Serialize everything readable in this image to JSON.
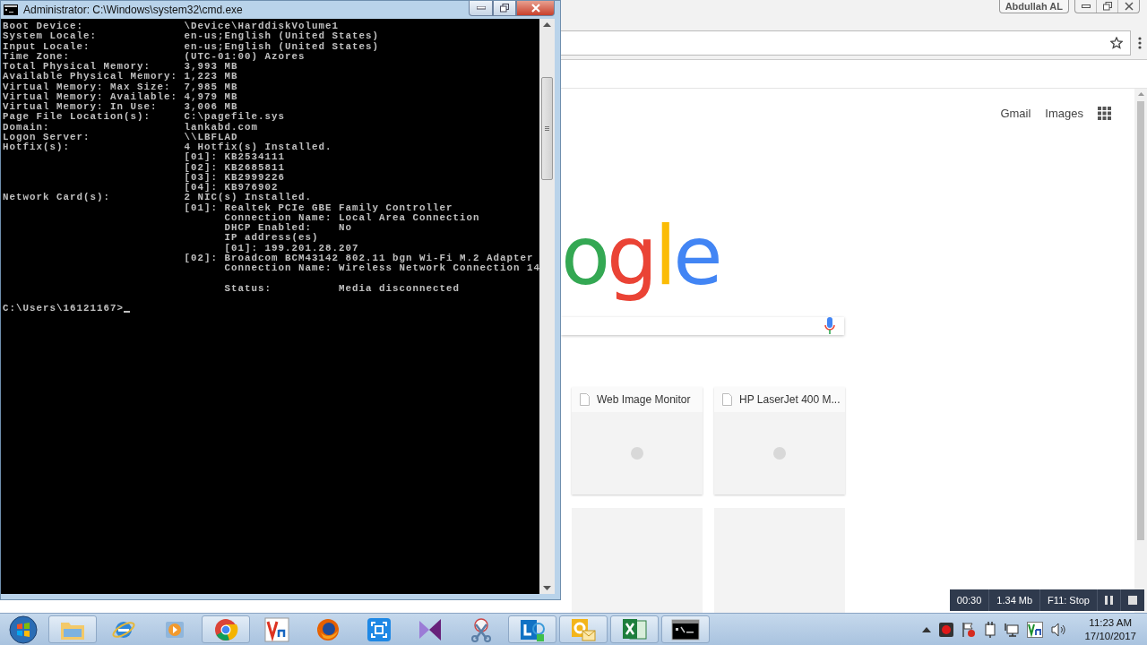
{
  "cmd_window": {
    "title": "Administrator: C:\\Windows\\system32\\cmd.exe",
    "lines": [
      {
        "text": "Boot Device:               \\Device\\HarddiskVolume1"
      },
      {
        "text": "System Locale:             en-us;English (United States)"
      },
      {
        "text": "Input Locale:              en-us;English (United States)"
      },
      {
        "text": "Time Zone:                 (UTC-01:00) Azores"
      },
      {
        "text": "Total Physical Memory:     3,993 MB"
      },
      {
        "text": "Available Physical Memory: 1,223 MB"
      },
      {
        "text": "Virtual Memory: Max Size:  7,985 MB"
      },
      {
        "text": "Virtual Memory: Available: 4,979 MB"
      },
      {
        "text": "Virtual Memory: In Use:    3,006 MB"
      },
      {
        "text": "Page File Location(s):     C:\\pagefile.sys"
      },
      {
        "text": "Domain:                    lankabd.com"
      },
      {
        "text": "Logon Server:              \\\\LBFLAD"
      },
      {
        "text": "Hotfix(s):                 4 Hotfix(s) Installed."
      },
      {
        "text": "                           [01]: KB2534111"
      },
      {
        "text": "                           [02]: KB2685811"
      },
      {
        "text": "                           [03]: KB2999226"
      },
      {
        "text": "                           [04]: KB976902"
      },
      {
        "text": "Network Card(s):           2 NIC(s) Installed."
      },
      {
        "text": "                           [01]: Realtek PCIe GBE Family Controller"
      },
      {
        "text": "                                 Connection Name: Local Area Connection"
      },
      {
        "text": "                                 DHCP Enabled:    No"
      },
      {
        "text": "                                 IP address(es)"
      },
      {
        "text": "                                 [01]: 199.201.28.207"
      },
      {
        "text": "                           [02]: Broadcom BCM43142 802.11 bgn Wi-Fi M.2 Adapter"
      },
      {
        "text": "                                 Connection Name: Wireless Network Connection 14"
      },
      {
        "text": "                                 Status:          Media disconnected",
        "blank_before": true
      },
      {
        "text": "C:\\Users\\16121167>",
        "blank_before": true,
        "cursor": true
      }
    ]
  },
  "browser": {
    "profile": "Abdullah AL",
    "links": [
      "Gmail",
      "Images"
    ],
    "logo": "ogle",
    "tiles": [
      {
        "kind": "site",
        "title": "Web Image Monitor"
      },
      {
        "kind": "site",
        "title": "HP LaserJet 400 M..."
      },
      {
        "kind": "empty"
      },
      {
        "kind": "empty"
      }
    ]
  },
  "recorder": {
    "time": "00:30",
    "size": "1.34 Mb",
    "hotkey": "F11: Stop"
  },
  "taskbar": {
    "items": [
      {
        "kind": "folder",
        "running": true
      },
      {
        "kind": "ie",
        "running": false
      },
      {
        "kind": "media",
        "running": false
      },
      {
        "kind": "chrome",
        "running": true
      },
      {
        "kind": "vnc",
        "running": false
      },
      {
        "kind": "firefox",
        "running": false
      },
      {
        "kind": "capture",
        "running": false
      },
      {
        "kind": "vs",
        "running": false
      },
      {
        "kind": "snip",
        "running": false
      },
      {
        "kind": "lync",
        "running": true
      },
      {
        "kind": "outlook",
        "running": true
      },
      {
        "kind": "excel",
        "running": true
      },
      {
        "kind": "console",
        "running": true
      }
    ],
    "tray": [
      {
        "kind": "arrow"
      },
      {
        "kind": "record"
      },
      {
        "kind": "flag"
      },
      {
        "kind": "power"
      },
      {
        "kind": "network"
      },
      {
        "kind": "vnc"
      },
      {
        "kind": "speaker"
      }
    ],
    "clock": {
      "time": "11:23 AM",
      "date": "17/10/2017"
    }
  }
}
